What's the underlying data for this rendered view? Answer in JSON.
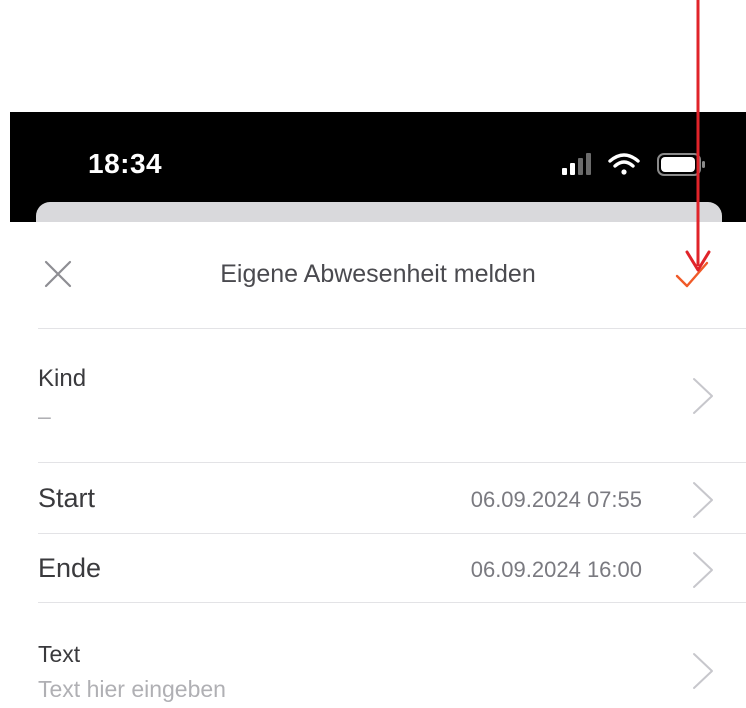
{
  "status_bar": {
    "time": "18:34",
    "icons": [
      "signal-icon",
      "wifi-icon",
      "battery-icon"
    ]
  },
  "header": {
    "title": "Eigene Abwesenheit melden",
    "close_icon": "close-icon",
    "confirm_icon": "checkmark-icon",
    "confirm_color": "#f05a28"
  },
  "rows": {
    "kind": {
      "label": "Kind",
      "value": "–"
    },
    "start": {
      "label": "Start",
      "value": "06.09.2024 07:55"
    },
    "ende": {
      "label": "Ende",
      "value": "06.09.2024 16:00"
    },
    "text": {
      "label": "Text",
      "placeholder": "Text hier eingeben"
    }
  },
  "annotation": {
    "arrow_color": "#e0242a",
    "icon": "annotation-arrow-icon"
  }
}
